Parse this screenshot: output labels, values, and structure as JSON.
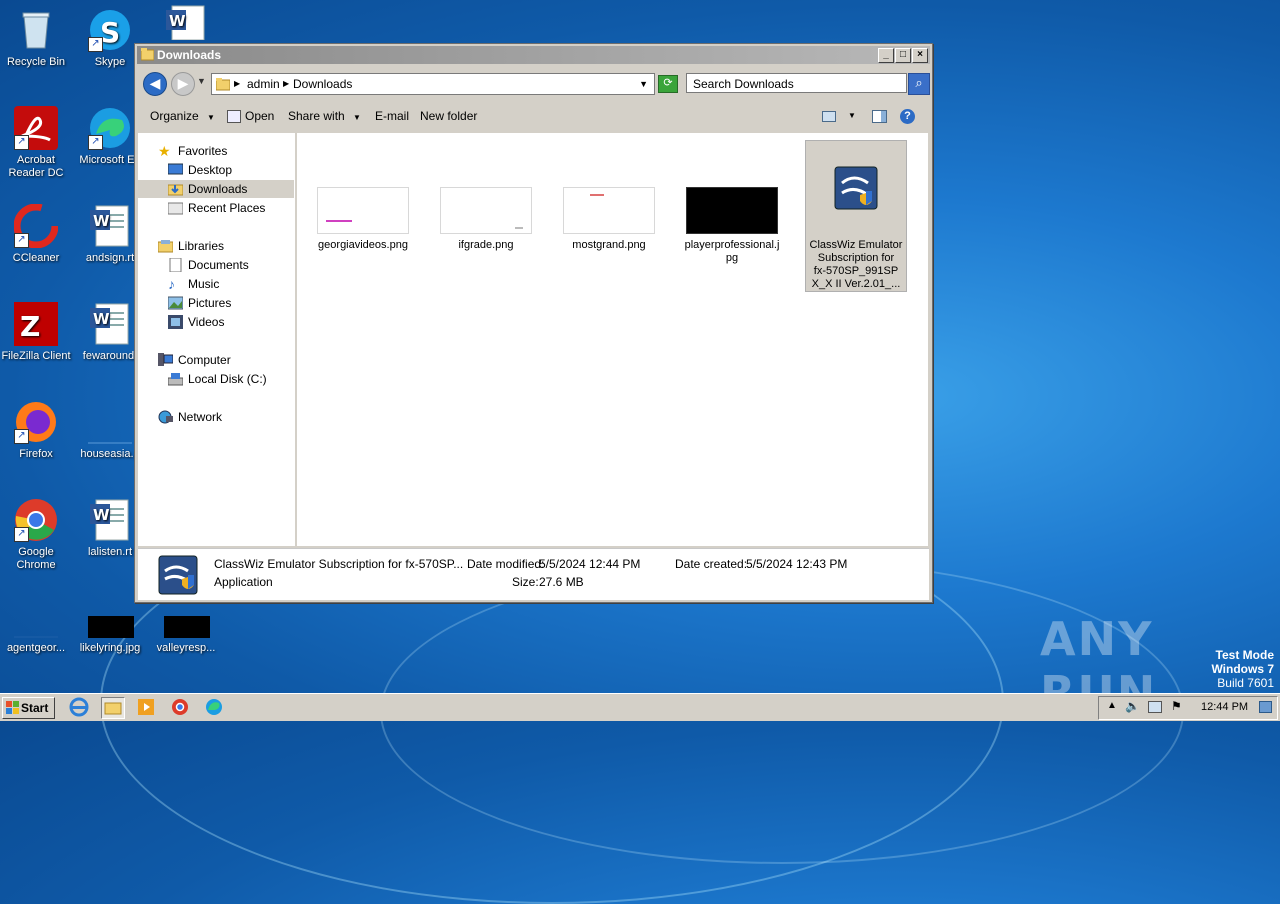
{
  "desktop": {
    "icons": [
      {
        "label": "Recycle Bin"
      },
      {
        "label": "Skype"
      },
      {
        "label": "Acrobat Reader DC"
      },
      {
        "label": "Microsoft Ed"
      },
      {
        "label": "CCleaner"
      },
      {
        "label": "andsign.rt"
      },
      {
        "label": "FileZilla Client"
      },
      {
        "label": "fewaround."
      },
      {
        "label": "Firefox"
      },
      {
        "label": "houseasia.p"
      },
      {
        "label": "Google Chrome"
      },
      {
        "label": "lalisten.rt"
      },
      {
        "label": "agentgeor..."
      },
      {
        "label": "likelyring.jpg"
      },
      {
        "label": "valleyresp..."
      }
    ],
    "watermark": "ANY RUN",
    "test_mode": {
      "line1": "Test Mode",
      "line2": "Windows 7",
      "line3": "Build 7601"
    }
  },
  "window": {
    "title": "Downloads",
    "breadcrumb": [
      "admin",
      "Downloads"
    ],
    "search_placeholder": "Search Downloads",
    "toolbar": {
      "organize": "Organize",
      "open": "Open",
      "share_with": "Share with",
      "email": "E-mail",
      "new_folder": "New folder"
    },
    "nav": {
      "favorites": "Favorites",
      "desktop": "Desktop",
      "downloads": "Downloads",
      "recent_places": "Recent Places",
      "libraries": "Libraries",
      "documents": "Documents",
      "music": "Music",
      "pictures": "Pictures",
      "videos": "Videos",
      "computer": "Computer",
      "local_disk": "Local Disk (C:)",
      "network": "Network"
    },
    "files": [
      {
        "name": "georgiavideos.png"
      },
      {
        "name": "ifgrade.png"
      },
      {
        "name": "mostgrand.png"
      },
      {
        "name": "playerprofessional.jpg",
        "line1": "playerprofessional.j",
        "line2": "pg"
      },
      {
        "name": "ClassWiz Emulator Subscription for fx-570SP_991SP X_X II Ver.2.01_...",
        "line1": "ClassWiz Emulator",
        "line2": "Subscription for",
        "line3": "fx-570SP_991SP",
        "line4": "X_X II Ver.2.01_..."
      }
    ],
    "details": {
      "name": "ClassWiz Emulator Subscription for fx-570SP...",
      "type": "Application",
      "date_modified_label": "Date modified:",
      "date_modified": "5/5/2024 12:44 PM",
      "size_label": "Size:",
      "size": "27.6 MB",
      "date_created_label": "Date created:",
      "date_created": "5/5/2024 12:43 PM"
    }
  },
  "taskbar": {
    "start": "Start",
    "clock": "12:44 PM"
  }
}
